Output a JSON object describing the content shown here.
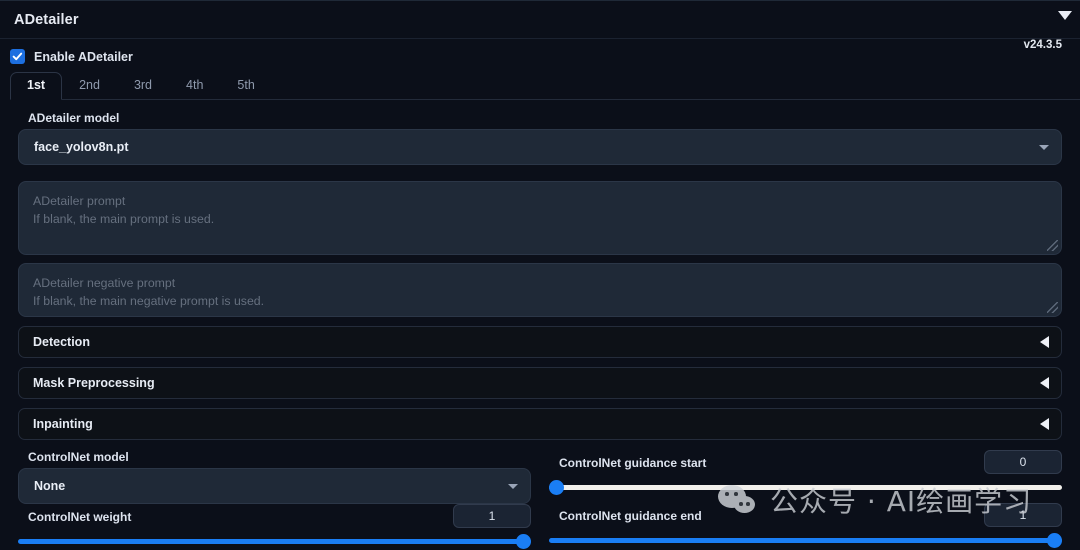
{
  "panel": {
    "title": "ADetailer",
    "version": "v24.3.5",
    "collapse_icon": "chevron-down-icon"
  },
  "enable": {
    "label": "Enable ADetailer",
    "checked": true,
    "icon": "checkmark-icon"
  },
  "tabs": [
    {
      "label": "1st",
      "active": true
    },
    {
      "label": "2nd",
      "active": false
    },
    {
      "label": "3rd",
      "active": false
    },
    {
      "label": "4th",
      "active": false
    },
    {
      "label": "5th",
      "active": false
    }
  ],
  "model": {
    "label": "ADetailer model",
    "value": "face_yolov8n.pt",
    "caret_icon": "chevron-down-icon"
  },
  "prompt": {
    "placeholder_title": "ADetailer prompt",
    "placeholder_hint": "If blank, the main prompt is used.",
    "value": "",
    "resize_icon": "resize-grip-icon"
  },
  "negative_prompt": {
    "placeholder_title": "ADetailer negative prompt",
    "placeholder_hint": "If blank, the main negative prompt is used.",
    "value": "",
    "resize_icon": "resize-grip-icon"
  },
  "accordions": [
    {
      "title": "Detection",
      "arrow_icon": "chevron-left-icon",
      "expanded": false
    },
    {
      "title": "Mask Preprocessing",
      "arrow_icon": "chevron-left-icon",
      "expanded": false
    },
    {
      "title": "Inpainting",
      "arrow_icon": "chevron-left-icon",
      "expanded": false
    }
  ],
  "controlnet": {
    "model": {
      "label": "ControlNet model",
      "value": "None",
      "caret_icon": "chevron-down-icon"
    },
    "weight": {
      "label": "ControlNet weight",
      "value": "1",
      "fill_percent": 100
    },
    "guidance_start": {
      "label": "ControlNet guidance start",
      "value": "0",
      "fill_percent": 0
    },
    "guidance_end": {
      "label": "ControlNet guidance end",
      "value": "1",
      "fill_percent": 100
    }
  },
  "watermark": {
    "text": "公众号 · AI绘画学习",
    "logo_icon": "wechat-logo-icon"
  },
  "colors": {
    "accent_blue": "#1a7ef5",
    "checkbox_blue": "#1d6fe0",
    "panel_bg": "#0b0f19",
    "field_bg": "#1f2937",
    "accordion_bg": "#0d1117",
    "slider_white": "#f2f0ec"
  }
}
